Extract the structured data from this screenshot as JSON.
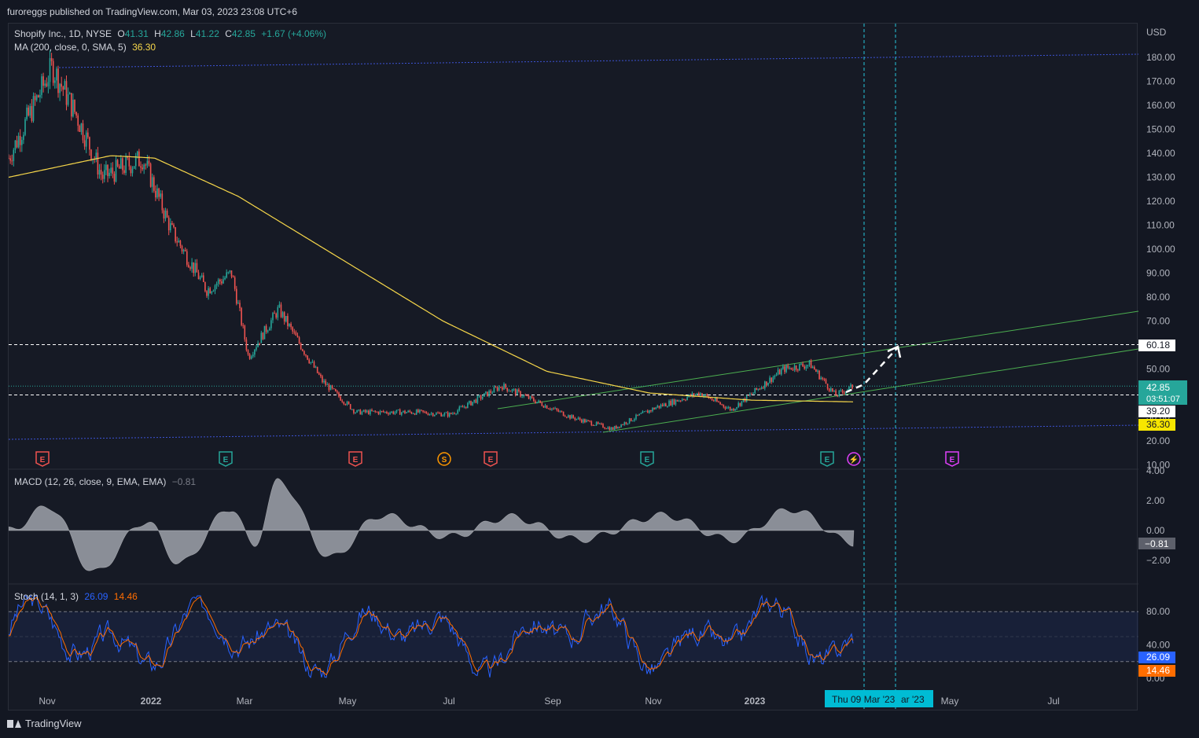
{
  "publisher": "furoreggs published on TradingView.com, Mar 03, 2023 23:08 UTC+6",
  "footer_brand": "TradingView",
  "currency": "USD",
  "main_legend": {
    "symbol": "Shopify Inc., 1D, NYSE",
    "o_label": "O",
    "o": "41.31",
    "h_label": "H",
    "h": "42.86",
    "l_label": "L",
    "l": "41.22",
    "c_label": "C",
    "c": "42.85",
    "change": "+1.67 (+4.06%)"
  },
  "ma_legend": {
    "label": "MA (200, close, 0, SMA, 5)",
    "value": "36.30"
  },
  "macd_legend": {
    "label": "MACD (12, 26, close, 9, EMA, EMA)",
    "value": "−0.81"
  },
  "stoch_legend": {
    "label": "Stoch (14, 1, 3)",
    "k": "26.09",
    "d": "14.46"
  },
  "price_axis": [
    "180.00",
    "170.00",
    "160.00",
    "150.00",
    "140.00",
    "130.00",
    "120.00",
    "110.00",
    "100.00",
    "90.00",
    "80.00",
    "70.00",
    "60.00",
    "50.00",
    "40.00",
    "30.00",
    "20.00",
    "10.00"
  ],
  "price_labels": {
    "target": "60.18",
    "last": "42.85",
    "countdown": "03:51:07",
    "support": "39.20",
    "ma": "36.30"
  },
  "macd_axis": [
    "4.00",
    "2.00",
    "0.00",
    "−2.00"
  ],
  "macd_label": "−0.81",
  "stoch_axis": [
    "80.00",
    "40.00",
    "0.00"
  ],
  "stoch_labels": {
    "k": "26.09",
    "d": "14.46"
  },
  "time_axis": [
    "Nov",
    "2022",
    "Mar",
    "May",
    "Jul",
    "Sep",
    "Nov",
    "2023",
    "May",
    "Jul"
  ],
  "time_crosshair": "Thu 09 Mar '23",
  "time_crosshair_tail": "ar '23",
  "events": [
    {
      "label": "E",
      "type": "earnings-miss"
    },
    {
      "label": "E",
      "type": "earnings-beat"
    },
    {
      "label": "E",
      "type": "earnings-miss"
    },
    {
      "label": "S",
      "type": "split"
    },
    {
      "label": "E",
      "type": "earnings-miss"
    },
    {
      "label": "E",
      "type": "earnings-beat"
    },
    {
      "label": "E",
      "type": "earnings-beat"
    },
    {
      "label": "⚡",
      "type": "news"
    },
    {
      "label": "E",
      "type": "earnings-upcoming"
    }
  ],
  "colors": {
    "up": "#26a69a",
    "down": "#ef5350",
    "ma": "#f7d74a",
    "channel": "#4caf50",
    "range": "#3d53d6",
    "stoch_k": "#2962ff",
    "stoch_d": "#ff6d00",
    "crosshair": "#26c6da",
    "macd_hist": "#b2b5be"
  },
  "chart_data": {
    "type": "candlestick",
    "title": "Shopify Inc., 1D, NYSE",
    "ylim": [
      10,
      185
    ],
    "price_series_keypoints": [
      {
        "date": "2021-10-15",
        "close": 138
      },
      {
        "date": "2021-11-10",
        "close": 176
      },
      {
        "date": "2021-11-25",
        "close": 155
      },
      {
        "date": "2021-12-10",
        "close": 130
      },
      {
        "date": "2022-01-03",
        "close": 138
      },
      {
        "date": "2022-01-20",
        "close": 108
      },
      {
        "date": "2022-02-10",
        "close": 83
      },
      {
        "date": "2022-02-25",
        "close": 90
      },
      {
        "date": "2022-03-07",
        "close": 55
      },
      {
        "date": "2022-03-25",
        "close": 75
      },
      {
        "date": "2022-04-20",
        "close": 45
      },
      {
        "date": "2022-05-10",
        "close": 32
      },
      {
        "date": "2022-06-15",
        "close": 32
      },
      {
        "date": "2022-07-05",
        "close": 31
      },
      {
        "date": "2022-08-05",
        "close": 43
      },
      {
        "date": "2022-09-15",
        "close": 30
      },
      {
        "date": "2022-10-10",
        "close": 25
      },
      {
        "date": "2022-11-05",
        "close": 34
      },
      {
        "date": "2022-12-01",
        "close": 40
      },
      {
        "date": "2022-12-20",
        "close": 33
      },
      {
        "date": "2023-01-20",
        "close": 50
      },
      {
        "date": "2023-02-05",
        "close": 52
      },
      {
        "date": "2023-02-20",
        "close": 39
      },
      {
        "date": "2023-03-03",
        "close": 42.85
      }
    ],
    "ma200_keypoints": [
      {
        "date": "2021-10-15",
        "value": 130
      },
      {
        "date": "2021-12-15",
        "value": 139
      },
      {
        "date": "2022-01-10",
        "value": 138
      },
      {
        "date": "2022-03-01",
        "value": 122
      },
      {
        "date": "2022-05-01",
        "value": 96
      },
      {
        "date": "2022-07-01",
        "value": 70
      },
      {
        "date": "2022-09-01",
        "value": 49
      },
      {
        "date": "2022-11-01",
        "value": 40
      },
      {
        "date": "2023-01-01",
        "value": 37
      },
      {
        "date": "2023-03-03",
        "value": 36.3
      }
    ],
    "horizontal_levels": [
      60.18,
      39.2
    ],
    "macd": {
      "hist_keypoints": [
        {
          "date": "2021-10-15",
          "value": 0
        },
        {
          "date": "2021-11-08",
          "value": 1.6
        },
        {
          "date": "2021-12-05",
          "value": -2.8
        },
        {
          "date": "2022-01-05",
          "value": 0.6
        },
        {
          "date": "2022-01-25",
          "value": -2.2
        },
        {
          "date": "2022-02-25",
          "value": 1.5
        },
        {
          "date": "2022-03-10",
          "value": -1.0
        },
        {
          "date": "2022-03-25",
          "value": 3.3
        },
        {
          "date": "2022-04-25",
          "value": -1.8
        },
        {
          "date": "2022-05-25",
          "value": 1.0
        },
        {
          "date": "2022-07-05",
          "value": -0.4
        },
        {
          "date": "2022-08-10",
          "value": 0.9
        },
        {
          "date": "2022-09-20",
          "value": -0.6
        },
        {
          "date": "2022-11-10",
          "value": 1.0
        },
        {
          "date": "2022-12-20",
          "value": -0.6
        },
        {
          "date": "2023-01-25",
          "value": 1.4
        },
        {
          "date": "2023-03-03",
          "value": -0.81
        }
      ]
    },
    "stoch": {
      "k": 26.09,
      "d": 14.46,
      "upper_band": 80,
      "lower_band": 20
    }
  }
}
